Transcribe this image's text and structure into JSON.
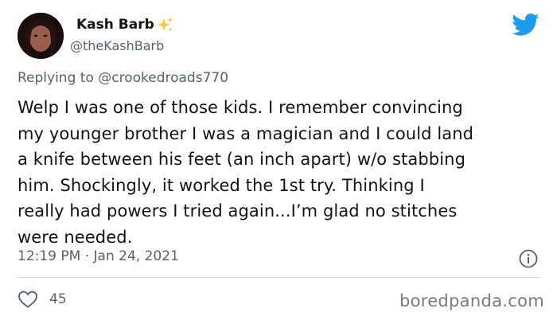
{
  "tweet": {
    "display_name": "Kash Barb",
    "name_emoji_icon": "sparkles-icon",
    "handle": "@theKashBarb",
    "replying_to_prefix": "Replying to ",
    "replying_to_user": "@crookedroads770",
    "body_lines": [
      "Welp I was one of those kids. I remember convincing",
      "my younger brother I was a magician and I could land",
      "a knife between his feet (an inch apart) w/o stabbing",
      "him. Shockingly, it worked the 1st try. Thinking I",
      "really had powers I tried again...I’m glad no stitches",
      "were needed."
    ],
    "timestamp": "12:19 PM · Jan 24, 2021",
    "like_count": "45"
  },
  "watermark": "boredpanda.com",
  "colors": {
    "twitter_blue": "#1d9bf0",
    "secondary_text": "#536471",
    "primary_text": "#0f1419",
    "sparkle": "#f7c948",
    "divider": "#cfd9de"
  }
}
